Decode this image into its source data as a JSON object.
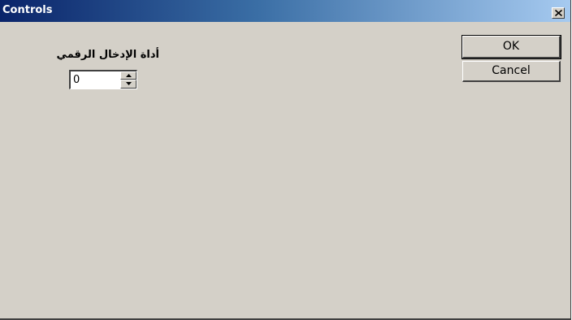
{
  "window": {
    "title": "Controls",
    "close_label": "×"
  },
  "form": {
    "numeric_label": "أداة الإدخال الرقمي",
    "numeric_value": "0"
  },
  "buttons": {
    "ok_label": "OK",
    "cancel_label": "Cancel"
  },
  "colors": {
    "face": "#d4d0c8",
    "titlebar_start": "#0a246a",
    "titlebar_end": "#a6caf0"
  }
}
